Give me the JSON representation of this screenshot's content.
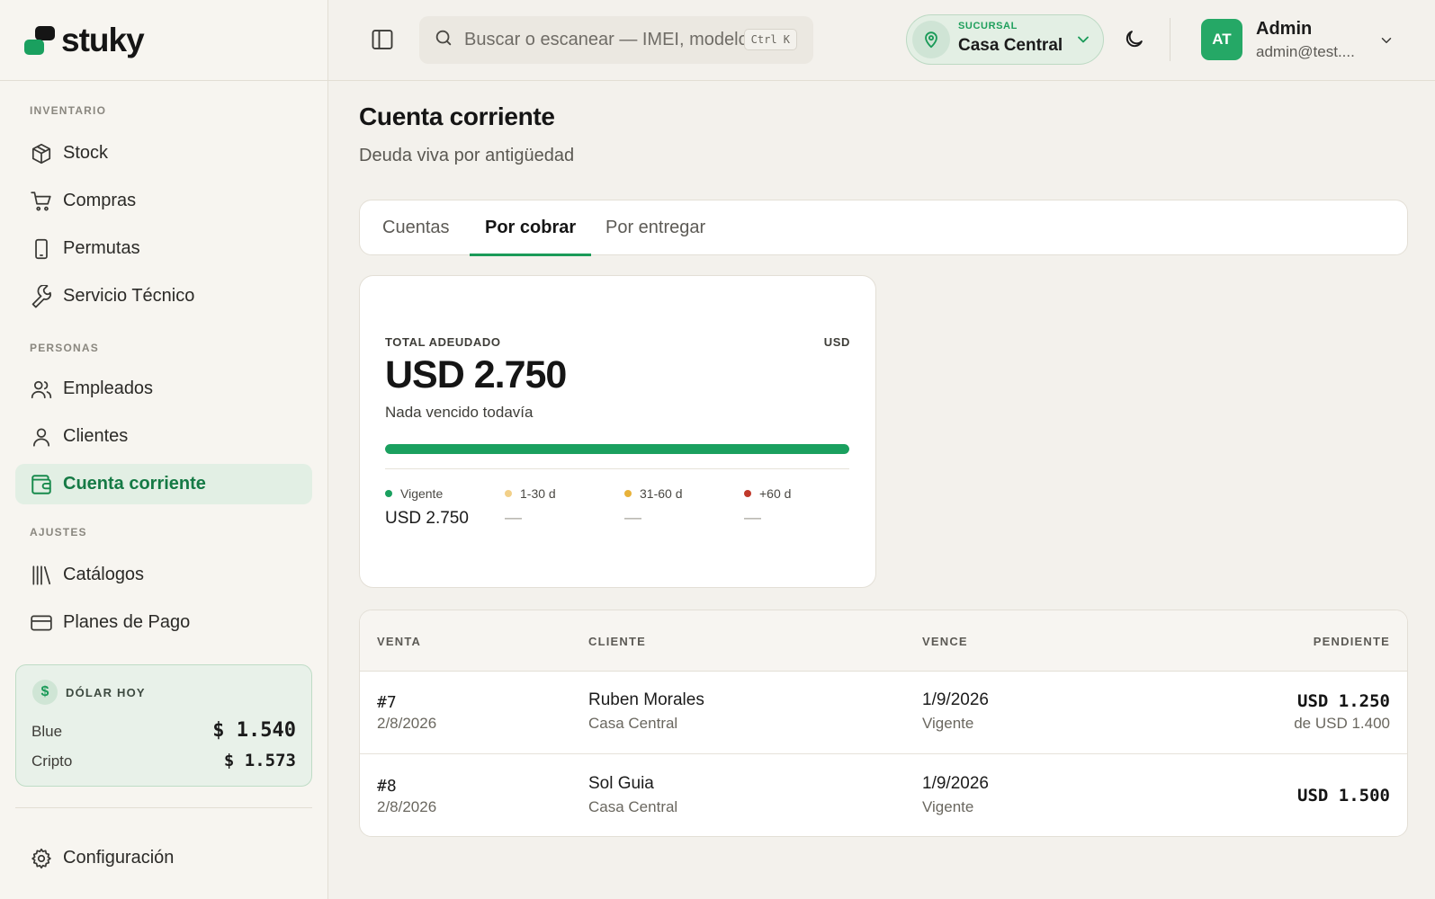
{
  "brand": {
    "name": "stuky"
  },
  "sidebar": {
    "sections": {
      "inventario": "INVENTARIO",
      "personas": "PERSONAS",
      "ajustes": "AJUSTES"
    },
    "items": {
      "stock": "Stock",
      "compras": "Compras",
      "permutas": "Permutas",
      "servicio": "Servicio Técnico",
      "empleados": "Empleados",
      "clientes": "Clientes",
      "cuenta": "Cuenta corriente",
      "catalogos": "Catálogos",
      "planes": "Planes de Pago"
    },
    "active": "cuenta",
    "dolar": {
      "title": "DÓLAR HOY",
      "badge": "$",
      "rows": [
        {
          "label": "Blue",
          "value": "$ 1.540"
        },
        {
          "label": "Cripto",
          "value": "$ 1.573"
        }
      ]
    },
    "config": "Configuración"
  },
  "topbar": {
    "search_placeholder": "Buscar o escanear — IMEI, modelo, c",
    "search_shortcut": "Ctrl K",
    "branch_label": "SUCURSAL",
    "branch_name": "Casa Central",
    "user_initials": "AT",
    "user_name": "Admin",
    "user_email": "admin@test...."
  },
  "page": {
    "title": "Cuenta corriente",
    "subtitle": "Deuda viva por antigüedad",
    "tabs": [
      "Cuentas",
      "Por cobrar",
      "Por entregar"
    ],
    "active_tab": 1
  },
  "summary": {
    "label": "TOTAL ADEUDADO",
    "currency": "USD",
    "total": "USD 2.750",
    "note": "Nada vencido todavía",
    "vigente_fraction": 1.0,
    "buckets": [
      {
        "label": "Vigente",
        "value": "USD 2.750",
        "color": "#1aa05f"
      },
      {
        "label": "1-30 d",
        "value": "—",
        "color": "#f2d089"
      },
      {
        "label": "31-60 d",
        "value": "—",
        "color": "#e8b23a"
      },
      {
        "label": "+60 d",
        "value": "—",
        "color": "#c0392b"
      }
    ]
  },
  "table": {
    "headers": {
      "venta": "VENTA",
      "cliente": "CLIENTE",
      "vence": "VENCE",
      "pendiente": "PENDIENTE"
    },
    "rows": [
      {
        "venta": "#7",
        "fecha": "2/8/2026",
        "cliente": "Ruben Morales",
        "sucursal": "Casa Central",
        "vence": "1/9/2026",
        "estado": "Vigente",
        "pendiente": "USD 1.250",
        "de": "de USD 1.400"
      },
      {
        "venta": "#8",
        "fecha": "2/8/2026",
        "cliente": "Sol Guia",
        "sucursal": "Casa Central",
        "vence": "1/9/2026",
        "estado": "Vigente",
        "pendiente": "USD 1.500",
        "de": ""
      }
    ]
  },
  "colors": {
    "accent": "#1aa05f",
    "background": "#f3f1ec"
  }
}
